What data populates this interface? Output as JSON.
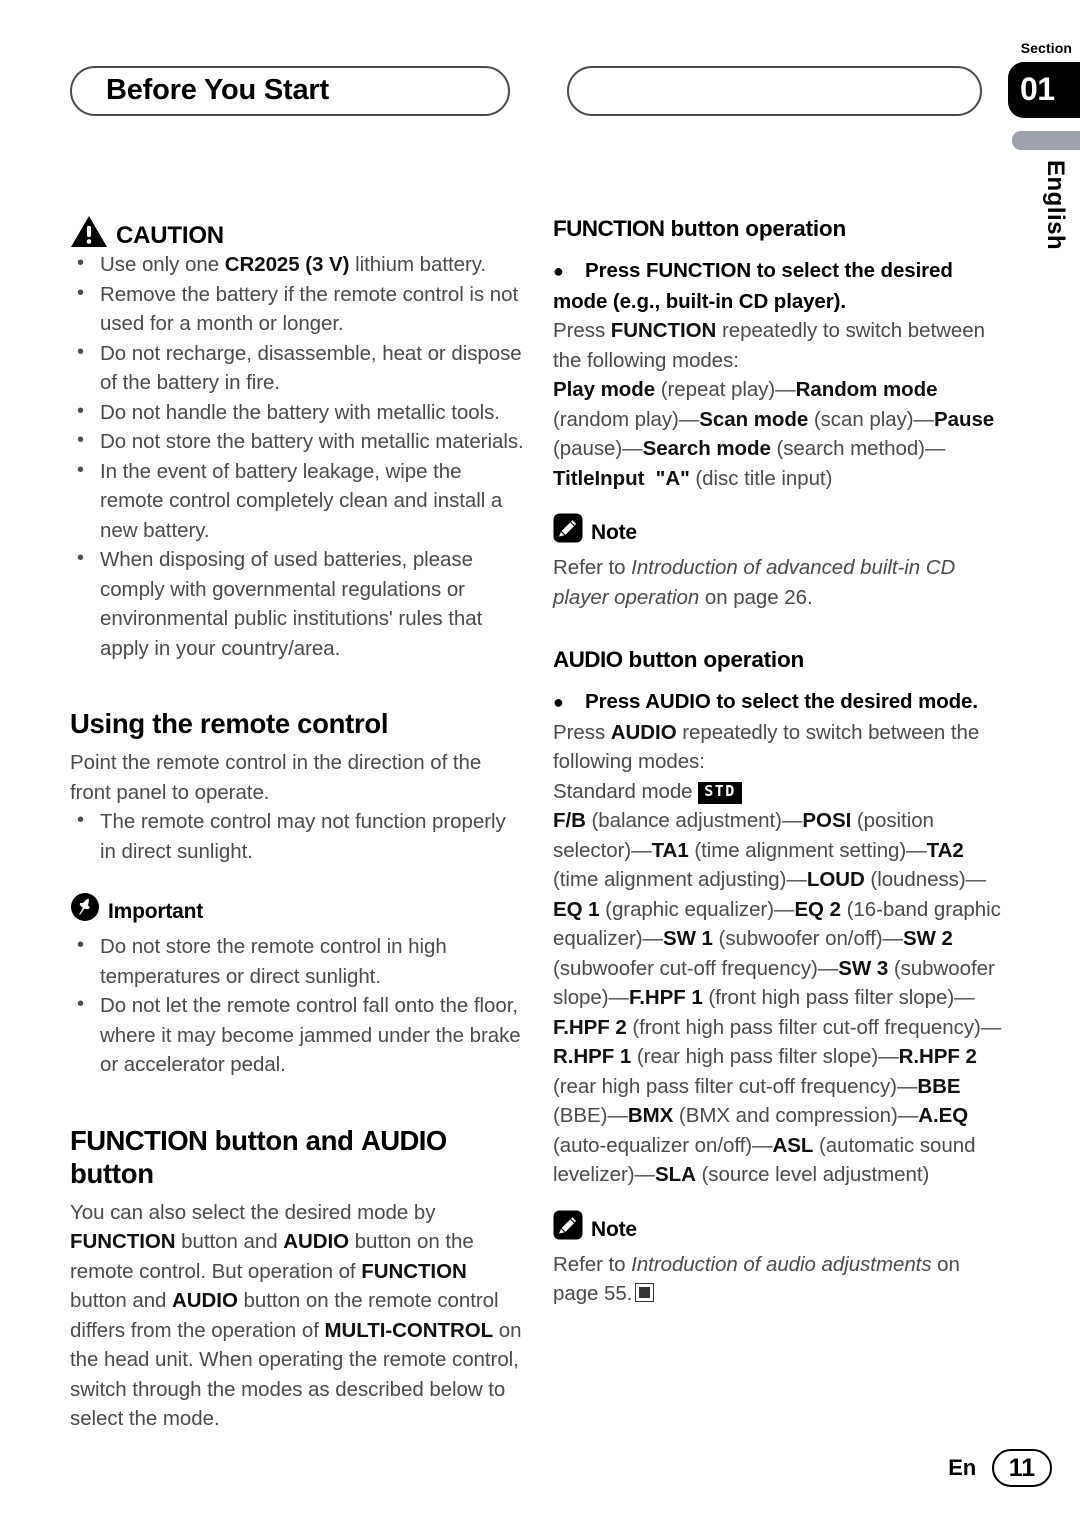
{
  "header": {
    "chapter_title": "Before You Start",
    "section_label": "Section",
    "section_number": "01",
    "language_tab": "English"
  },
  "left_column": {
    "caution": {
      "icon": "warning-triangle-icon",
      "label": "CAUTION",
      "items": [
        "Use only one <b>CR2025 (3 V)</b> lithium battery.",
        "Remove the battery if the remote control is not used for a month or longer.",
        "Do not recharge, disassemble, heat or dispose of the battery in fire.",
        "Do not handle the battery with metallic tools.",
        "Do not store the battery with metallic materials.",
        "In the event of battery leakage, wipe the remote control completely clean and install a new battery.",
        "When disposing of used batteries, please comply with governmental regulations or environmental public institutions' rules that apply in your country/area."
      ]
    },
    "using_remote": {
      "heading": "Using the remote control",
      "paragraph": "Point the remote control in the direction of the front panel to operate.",
      "items": [
        "The remote control may not function properly in direct sunlight."
      ]
    },
    "important": {
      "icon": "pin-icon",
      "label": "Important",
      "items": [
        "Do not store the remote control in high temperatures or direct sunlight.",
        "Do not let the remote control fall onto the floor, where it may become jammed under the brake or accelerator pedal."
      ]
    },
    "function_audio": {
      "heading_part1": "FUNCTION",
      "heading_part2": " button and ",
      "heading_part3": "AUDIO",
      "heading_part4": " button",
      "paragraph": "You can also select the desired mode by <b>FUNCTION</b> button and <b>AUDIO</b> button on the remote control. But operation of <b>FUNCTION</b> button and <b>AUDIO</b> button on the remote control differs from the operation of <b>MULTI-CONTROL</b> on the head unit. When operating the remote control, switch through the modes as described below to select the mode."
    }
  },
  "right_column": {
    "function_op": {
      "heading_part1": "FUNCTION",
      "heading_part2": " button operation",
      "bullet_bold": "Press FUNCTION to select the desired mode (e.g., built-in CD player).",
      "paragraph": "Press <b>FUNCTION</b> repeatedly to switch between the following modes:",
      "modes": "<b>Play mode</b> (repeat play)—<b>Random mode</b> (random play)—<b>Scan mode</b> (scan play)—<b>Pause</b> (pause)—<b>Search mode</b> (search method)—<b>TitleInput&nbsp; \"A\"</b> (disc title input)",
      "note": {
        "icon": "pencil-note-icon",
        "label": "Note",
        "text": "Refer to <i>Introduction of advanced built-in CD player operation</i> on page 26."
      }
    },
    "audio_op": {
      "heading_part1": "AUDIO",
      "heading_part2": " button operation",
      "bullet_bold": "Press AUDIO to select the desired mode.",
      "paragraph": "Press <b>AUDIO</b> repeatedly to switch between the following modes:",
      "standard_mode_label": "Standard mode",
      "standard_mode_badge": "STD",
      "modes": "<b>F/B</b> (balance adjustment)—<b>POSI</b> (position selector)—<b>TA1</b> (time alignment setting)—<b>TA2</b> (time alignment adjusting)—<b>LOUD</b> (loudness)—<b>EQ 1</b> (graphic equalizer)—<b>EQ 2</b> (16-band graphic equalizer)—<b>SW 1</b> (subwoofer on/off)—<b>SW 2</b> (subwoofer cut-off frequency)—<b>SW 3</b> (subwoofer slope)—<b>F.HPF 1</b> (front high pass filter slope)—<b>F.HPF 2</b> (front high pass filter cut-off frequency)—<b>R.HPF 1</b> (rear high pass filter slope)—<b>R.HPF 2</b> (rear high pass filter cut-off frequency)—<b>BBE</b> (BBE)—<b>BMX</b> (BMX and compression)—<b>A.EQ</b> (auto-equalizer on/off)—<b>ASL</b> (automatic sound levelizer)—<b>SLA</b> (source level adjustment)",
      "note": {
        "icon": "pencil-note-icon",
        "label": "Note",
        "text": "Refer to <i>Introduction of audio adjustments</i> on page 55."
      }
    }
  },
  "footer": {
    "language_code": "En",
    "page_number": "11"
  },
  "colors": {
    "body_text": "#4b4b4d",
    "heading": "#000000",
    "language_tab": "#9ea2ab",
    "section_tab": "#000000"
  }
}
